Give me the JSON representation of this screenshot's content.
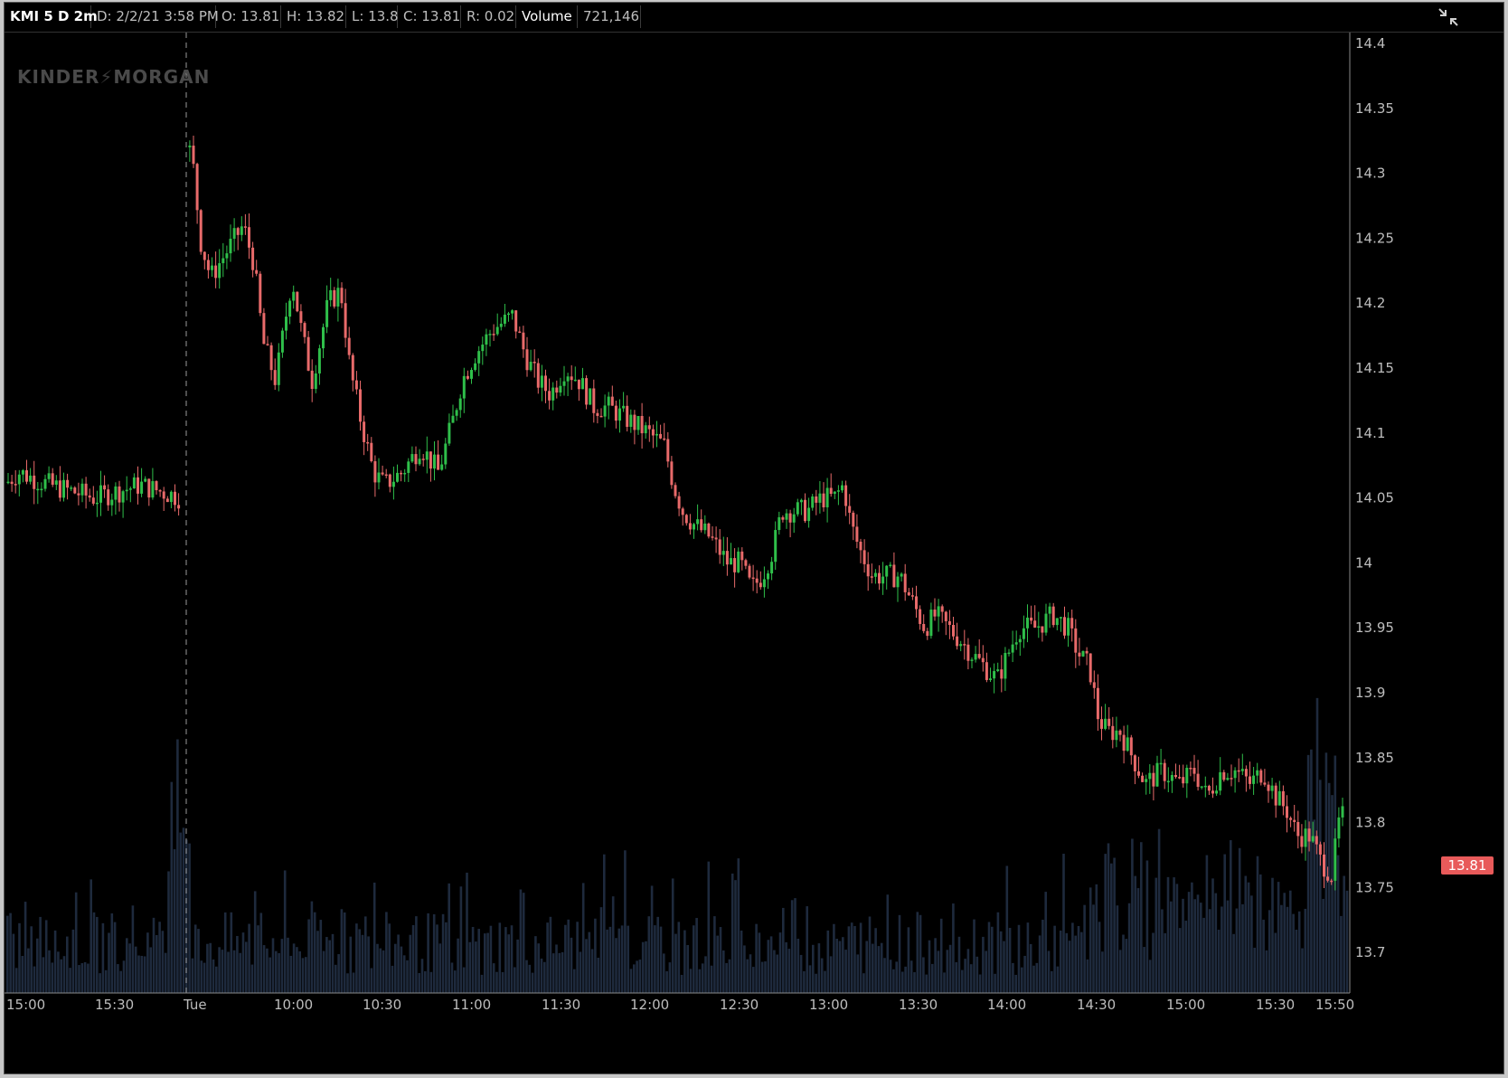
{
  "header": {
    "symbol_label": "KMI 5 D 2m",
    "date_label": "D: 2/2/21 3:58 PM",
    "open_label": "O: 13.81",
    "high_label": "H: 13.82",
    "low_label": "L: 13.8",
    "close_label": "C: 13.81",
    "range_label": "R: 0.02",
    "volume_label": "Volume",
    "volume_value": "721,146"
  },
  "logo": {
    "left": "KINDER",
    "bolt": "⚡",
    "right": "MORGAN"
  },
  "last_price_badge": "13.81",
  "colors": {
    "up": "#2fbf4a",
    "down": "#e86a6a",
    "volume": "#1e2a3d",
    "background": "#000000",
    "axis_text": "#bdbdbd",
    "badge": "#e85a5a"
  },
  "icons": {
    "reset_zoom": "zoom-reset-icon"
  },
  "chart_data": {
    "type": "candlestick",
    "title": "KMI 5 D 2m",
    "ylim": [
      13.67,
      14.42
    ],
    "y_ticks": [
      "14.4",
      "14.35",
      "14.3",
      "14.25",
      "14.2",
      "14.15",
      "14.1",
      "14.05",
      "14",
      "13.95",
      "13.9",
      "13.85",
      "13.8",
      "13.75",
      "13.7"
    ],
    "x_ticks": [
      "15:00",
      "15:30",
      "Tue",
      "10:00",
      "10:30",
      "11:00",
      "11:30",
      "12:00",
      "12:30",
      "13:00",
      "13:30",
      "14:00",
      "14:30",
      "15:00",
      "15:30",
      "15:50"
    ],
    "session_break": "Tue",
    "grid": false,
    "price_path": [
      [
        0,
        14.06
      ],
      [
        15,
        14.07
      ],
      [
        50,
        14.06
      ],
      [
        100,
        14.05
      ],
      [
        150,
        14.06
      ],
      [
        196,
        14.05
      ],
      [
        202,
        14.17
      ],
      [
        204,
        14.32
      ],
      [
        210,
        14.3
      ],
      [
        216,
        14.25
      ],
      [
        228,
        14.22
      ],
      [
        246,
        14.24
      ],
      [
        264,
        14.26
      ],
      [
        276,
        14.23
      ],
      [
        286,
        14.17
      ],
      [
        300,
        14.14
      ],
      [
        318,
        14.22
      ],
      [
        328,
        14.18
      ],
      [
        340,
        14.14
      ],
      [
        358,
        14.2
      ],
      [
        372,
        14.21
      ],
      [
        382,
        14.15
      ],
      [
        394,
        14.11
      ],
      [
        408,
        14.07
      ],
      [
        420,
        14.06
      ],
      [
        440,
        14.07
      ],
      [
        460,
        14.09
      ],
      [
        480,
        14.07
      ],
      [
        496,
        14.11
      ],
      [
        506,
        14.14
      ],
      [
        520,
        14.16
      ],
      [
        540,
        14.18
      ],
      [
        562,
        14.19
      ],
      [
        576,
        14.16
      ],
      [
        590,
        14.14
      ],
      [
        604,
        14.13
      ],
      [
        620,
        14.15
      ],
      [
        636,
        14.14
      ],
      [
        652,
        14.12
      ],
      [
        668,
        14.12
      ],
      [
        690,
        14.11
      ],
      [
        712,
        14.1
      ],
      [
        730,
        14.09
      ],
      [
        740,
        14.06
      ],
      [
        750,
        14.04
      ],
      [
        762,
        14.03
      ],
      [
        780,
        14.02
      ],
      [
        800,
        14.0
      ],
      [
        814,
        14.0
      ],
      [
        826,
        13.98
      ],
      [
        838,
        13.99
      ],
      [
        850,
        14.01
      ],
      [
        860,
        14.04
      ],
      [
        872,
        14.04
      ],
      [
        888,
        14.04
      ],
      [
        904,
        14.05
      ],
      [
        918,
        14.05
      ],
      [
        928,
        14.06
      ],
      [
        936,
        14.03
      ],
      [
        946,
        14.01
      ],
      [
        960,
        13.99
      ],
      [
        976,
        13.99
      ],
      [
        990,
        13.99
      ],
      [
        1004,
        13.97
      ],
      [
        1018,
        13.95
      ],
      [
        1030,
        13.96
      ],
      [
        1044,
        13.95
      ],
      [
        1058,
        13.94
      ],
      [
        1070,
        13.93
      ],
      [
        1084,
        13.92
      ],
      [
        1098,
        13.91
      ],
      [
        1110,
        13.93
      ],
      [
        1122,
        13.95
      ],
      [
        1140,
        13.95
      ],
      [
        1160,
        13.96
      ],
      [
        1176,
        13.95
      ],
      [
        1188,
        13.93
      ],
      [
        1200,
        13.92
      ],
      [
        1210,
        13.88
      ],
      [
        1220,
        13.87
      ],
      [
        1234,
        13.87
      ],
      [
        1248,
        13.85
      ],
      [
        1262,
        13.83
      ],
      [
        1280,
        13.84
      ],
      [
        1300,
        13.83
      ],
      [
        1316,
        13.84
      ],
      [
        1330,
        13.82
      ],
      [
        1346,
        13.84
      ],
      [
        1362,
        13.84
      ],
      [
        1378,
        13.83
      ],
      [
        1392,
        13.84
      ],
      [
        1406,
        13.82
      ],
      [
        1418,
        13.81
      ],
      [
        1430,
        13.79
      ],
      [
        1444,
        13.79
      ],
      [
        1456,
        13.77
      ],
      [
        1468,
        13.76
      ],
      [
        1476,
        13.8
      ],
      [
        1484,
        13.81
      ]
    ]
  }
}
